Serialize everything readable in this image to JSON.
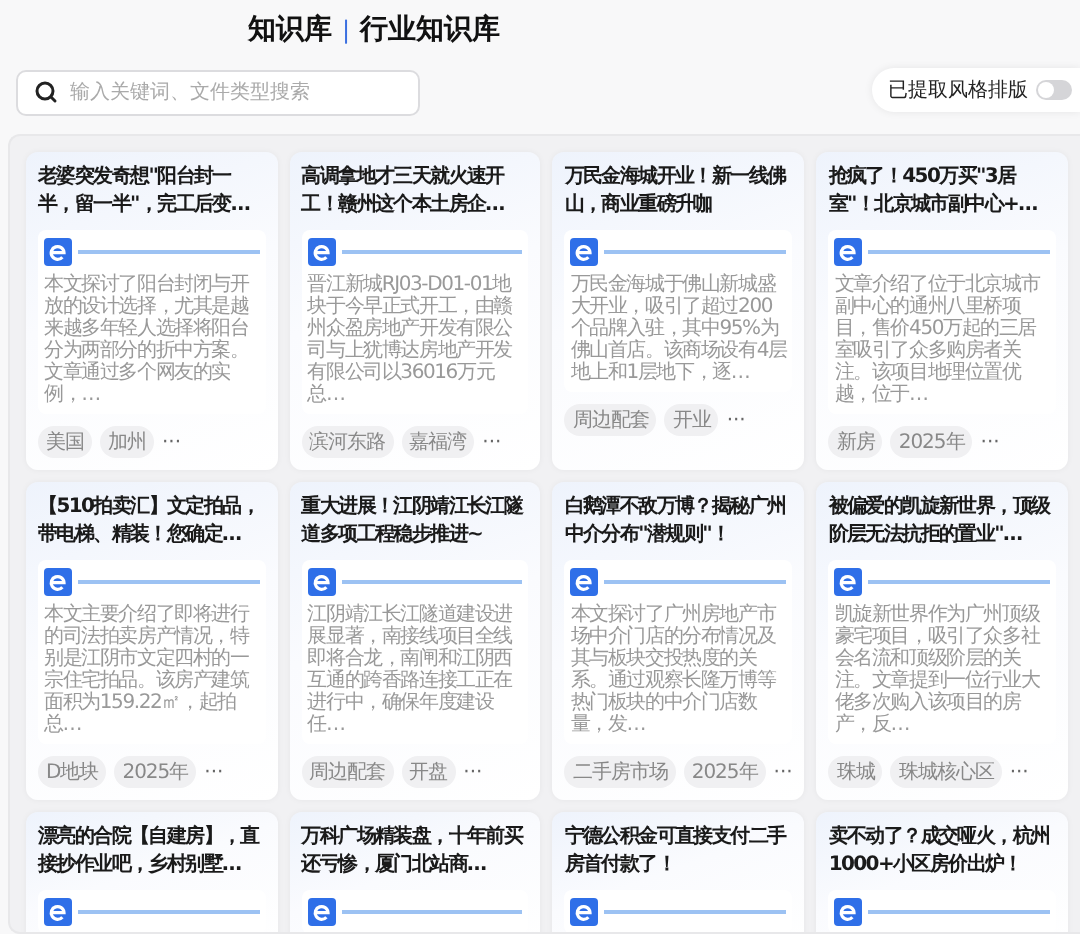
{
  "header": {
    "title": "知识库",
    "separator": "|",
    "subtitle": "行业知识库"
  },
  "search": {
    "placeholder": "输入关键词、文件类型搜索"
  },
  "style_toggle": {
    "label": "已提取风格排版",
    "on": false
  },
  "cards": [
    {
      "title": "老婆突发奇想\"阳台封一半，留一半\"，完工后变…",
      "summary": "本文探讨了阳台封闭与开放的设计选择，尤其是越来越多年轻人选择将阳台分为两部分的折中方案。文章通过多个网友的实例，…",
      "tags": [
        "美国",
        "加州"
      ],
      "more": "···"
    },
    {
      "title": "高调拿地才三天就火速开工！赣州这个本土房企…",
      "summary": "晋江新城RJ03-D01-01地块于今早正式开工，由赣州众盈房地产开发有限公司与上犹博达房地产开发有限公司以36016万元总…",
      "tags": [
        "滨河东路",
        "嘉福湾"
      ],
      "more": "···"
    },
    {
      "title": "万民金海城开业！新一线佛山，商业重磅升咖",
      "summary": "万民金海城于佛山新城盛大开业，吸引了超过200个品牌入驻，其中95%为佛山首店。该商场设有4层地上和1层地下，逐…",
      "tags": [
        "周边配套",
        "开业"
      ],
      "more": "···"
    },
    {
      "title": "抢疯了！450万买\"3居室\"！北京城市副中心+…",
      "summary": "文章介绍了位于北京城市副中心的通州八里桥项目，售价450万起的三居室吸引了众多购房者关注。该项目地理位置优越，位于…",
      "tags": [
        "新房",
        "2025年"
      ],
      "more": "···"
    },
    {
      "title": "【510拍卖汇】文定拍品，带电梯、精装！您确定…",
      "summary": "本文主要介绍了即将进行的司法拍卖房产情况，特别是江阴市文定四村的一宗住宅拍品。该房产建筑面积为159.22㎡，起拍总…",
      "tags": [
        "D地块",
        "2025年"
      ],
      "more": "···"
    },
    {
      "title": "重大进展！江阴靖江长江隧道多项工程稳步推进~",
      "summary": "江阴靖江长江隧道建设进展显著，南接线项目全线即将合龙，南闸和江阴西互通的跨香路连接工正在进行中，确保年度建设任…",
      "tags": [
        "周边配套",
        "开盘"
      ],
      "more": "···"
    },
    {
      "title": "白鹅潭不敌万博？揭秘广州中介分布\"潜规则\"！",
      "summary": "本文探讨了广州房地产市场中介门店的分布情况及其与板块交投热度的关系。通过观察长隆万博等热门板块的中介门店数量，发…",
      "tags": [
        "二手房市场",
        "2025年"
      ],
      "more": "···"
    },
    {
      "title": "被偏爱的凯旋新世界，顶级阶层无法抗拒的置业\"…",
      "summary": "凯旋新世界作为广州顶级豪宅项目，吸引了众多社会名流和顶级阶层的关注。文章提到一位行业大佬多次购入该项目的房产，反…",
      "tags": [
        "珠城",
        "珠城核心区"
      ],
      "more": "···"
    },
    {
      "title": "漂亮的合院【自建房】，直接抄作业吧，乡村别墅…"
    },
    {
      "title": "万科广场精装盘，十年前买还亏惨，厦门北站商…"
    },
    {
      "title": "宁德公积金可直接支付二手房首付款了！"
    },
    {
      "title": "卖不动了？成交哑火，杭州1000+小区房价出炉！"
    }
  ]
}
